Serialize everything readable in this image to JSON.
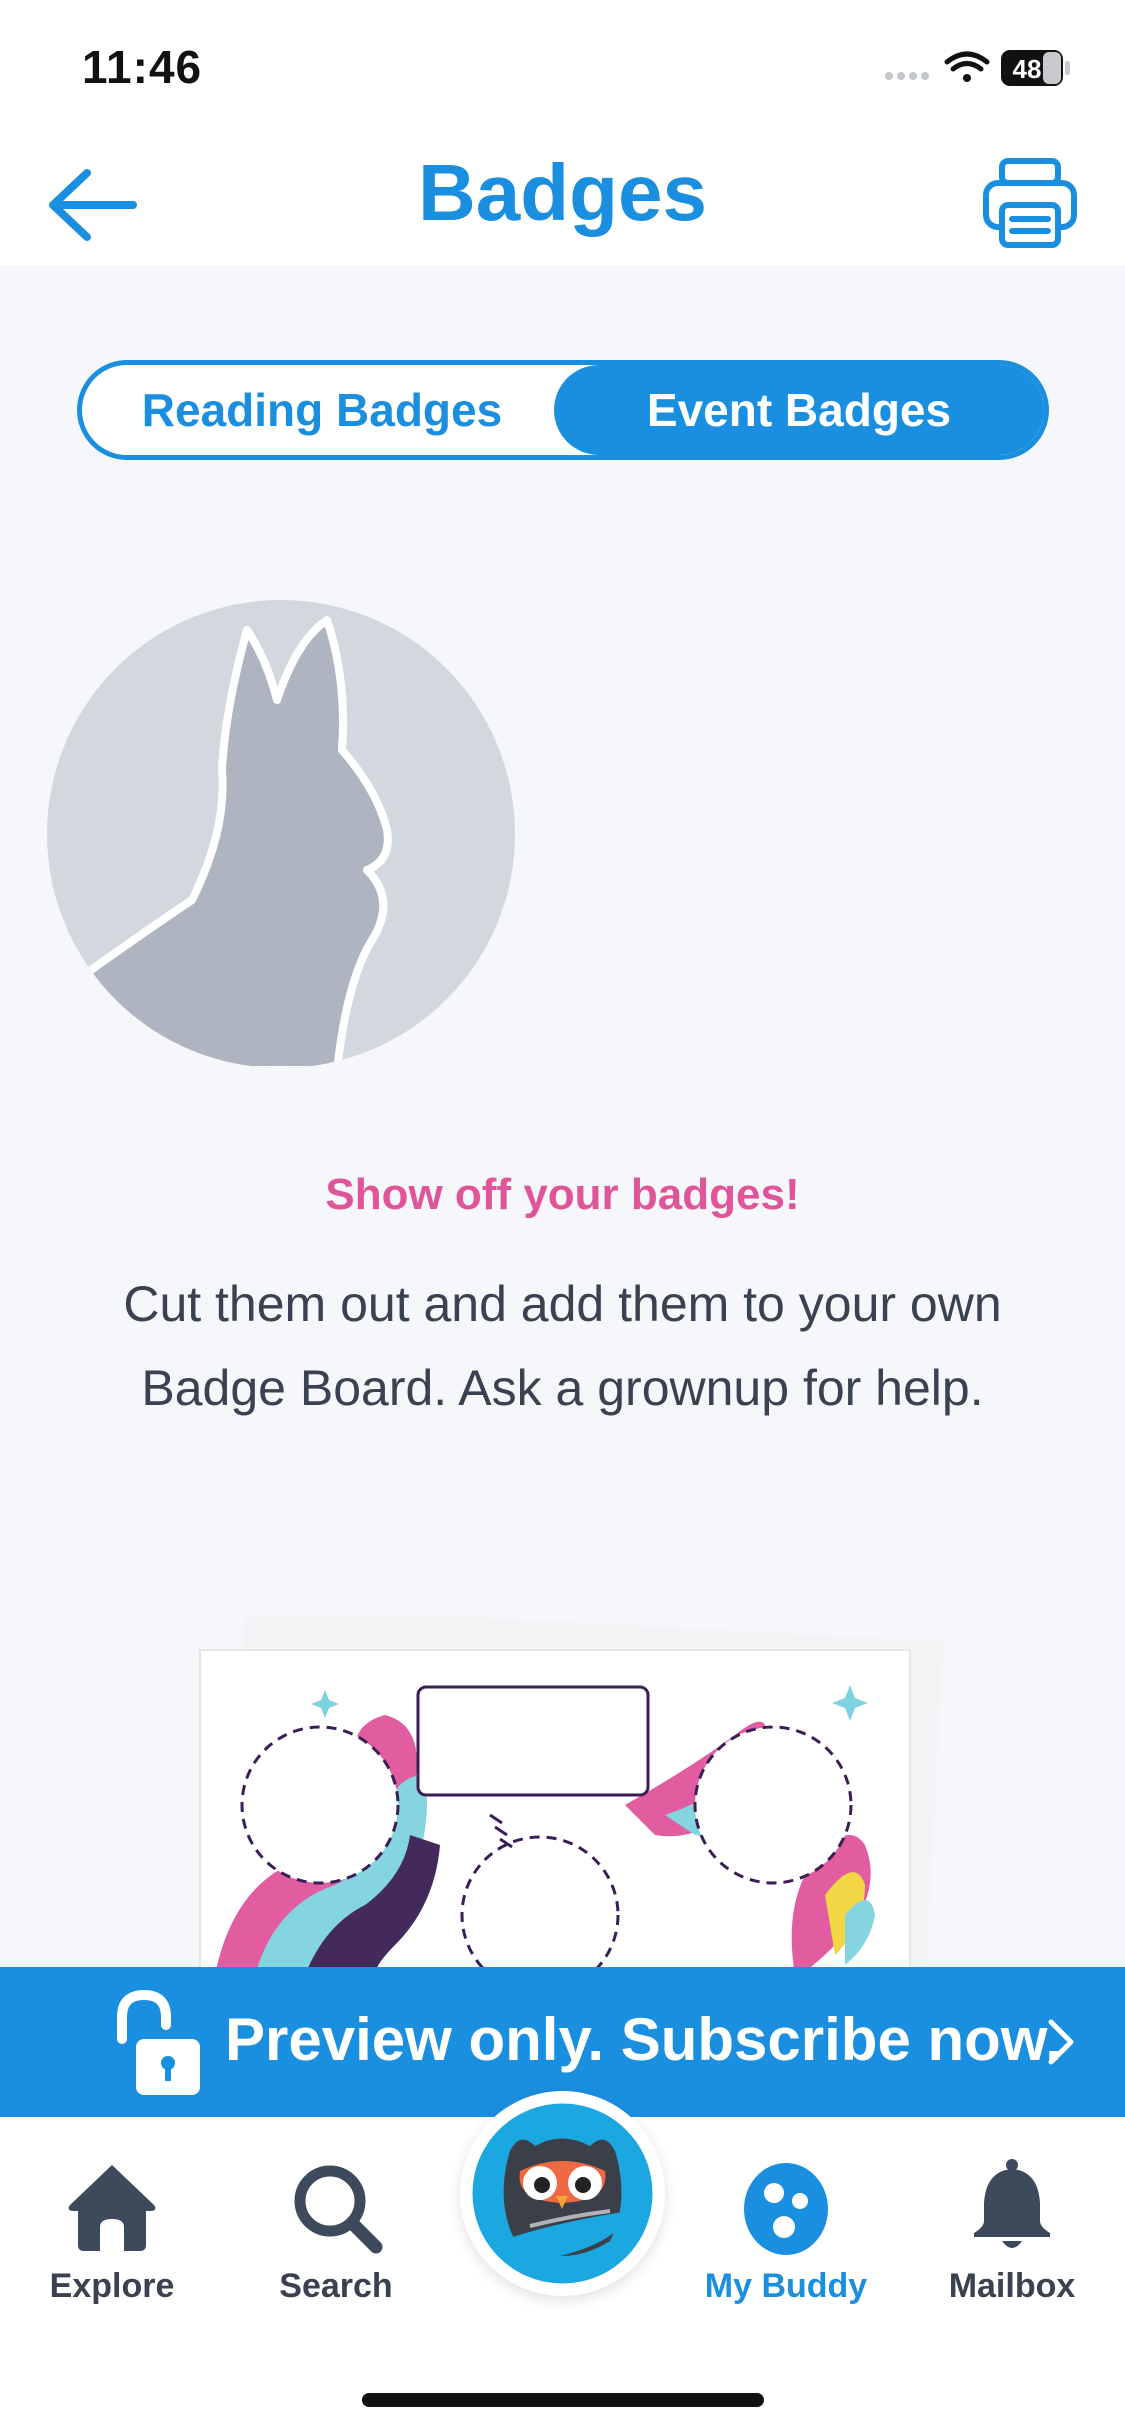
{
  "status_bar": {
    "time": "11:46",
    "battery": "48"
  },
  "header": {
    "title": "Badges"
  },
  "segments": {
    "reading": "Reading Badges",
    "event": "Event Badges",
    "selected": "Event Badges"
  },
  "promo": {
    "title": "Show off your badges!",
    "body": "Cut them out and add them to your own Badge Board. Ask a grownup for help."
  },
  "banner": {
    "text": "Preview only. Subscribe now."
  },
  "tabs": [
    {
      "label": "Explore",
      "icon": "home-icon"
    },
    {
      "label": "Search",
      "icon": "search-icon"
    },
    {
      "label": "My Buddy",
      "icon": "buddy-egg-icon"
    },
    {
      "label": "Mailbox",
      "icon": "bell-icon"
    }
  ],
  "colors": {
    "accent": "#1b8fdf",
    "pink": "#e0559a",
    "text": "#3a4150"
  }
}
